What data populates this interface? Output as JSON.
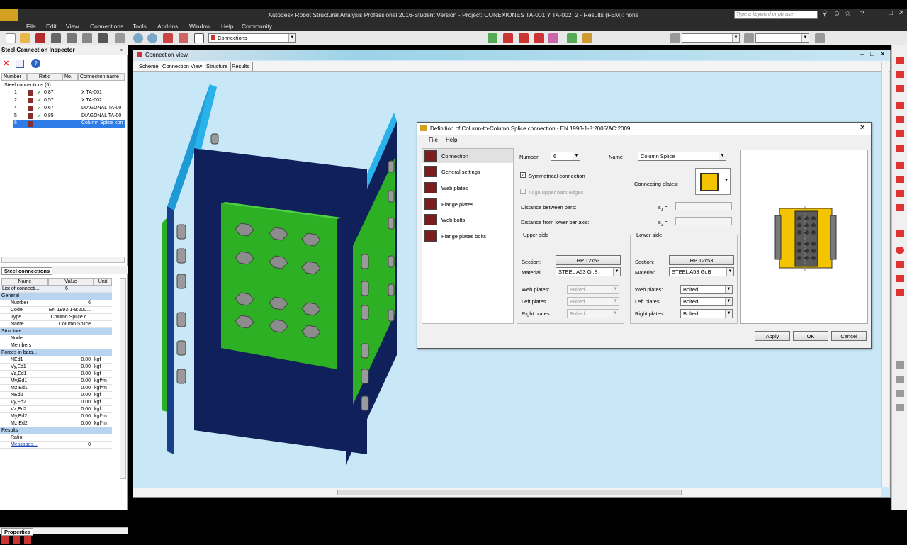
{
  "app": {
    "title": "Autodesk Robot Structural Analysis Professional 2016-Student Version - Project: CONEXIONES TA-001 Y TA-002_2 - Results (FEM): none",
    "search_placeholder": "Type a keyword or phrase"
  },
  "menu": [
    "File",
    "Edit",
    "View",
    "Connections",
    "Tools",
    "Add-Ins",
    "Window",
    "Help",
    "Community"
  ],
  "toolbar": {
    "connections_combo": "Connections"
  },
  "inspector": {
    "title": "Steel Connection Inspector",
    "columns": [
      "Number",
      "Ratio",
      "No.",
      "Connection name"
    ],
    "root_label": "Steel connections (5)",
    "rows": [
      {
        "number": "1",
        "ratio": "0.87",
        "name": "X TA-001"
      },
      {
        "number": "2",
        "ratio": "0.57",
        "name": "X TA-002"
      },
      {
        "number": "4",
        "ratio": "0.67",
        "name": "DIAGONAL TA-00"
      },
      {
        "number": "5",
        "ratio": "0.85",
        "name": "DIAGONAL TA-00"
      },
      {
        "number": "6",
        "ratio": "",
        "name": "Column Splice con"
      }
    ],
    "tab_label": "Steel connections"
  },
  "properties": {
    "columns": [
      "Name",
      "Value",
      "Unit"
    ],
    "list_label": "List of connecti...",
    "list_value": "6",
    "cat_general": "General",
    "general": [
      {
        "name": "Number",
        "value": "6",
        "unit": ""
      },
      {
        "name": "Code",
        "value": "EN 1993-1-8:200...",
        "unit": ""
      },
      {
        "name": "Type",
        "value": "Column Splice c...",
        "unit": ""
      },
      {
        "name": "Name",
        "value": "Column Splice",
        "unit": ""
      }
    ],
    "cat_structure": "Structure",
    "structure": [
      {
        "name": "Node",
        "value": "",
        "unit": ""
      },
      {
        "name": "Members",
        "value": "",
        "unit": ""
      }
    ],
    "cat_forces": "Forces in bars...",
    "forces": [
      {
        "name": "NEd1",
        "value": "0.00",
        "unit": "kgf"
      },
      {
        "name": "Vy,Ed1",
        "value": "0.00",
        "unit": "kgf"
      },
      {
        "name": "Vz,Ed1",
        "value": "0.00",
        "unit": "kgf"
      },
      {
        "name": "My,Ed1",
        "value": "0.00",
        "unit": "kgf*m"
      },
      {
        "name": "Mz,Ed1",
        "value": "0.00",
        "unit": "kgf*m"
      },
      {
        "name": "NEd2",
        "value": "0.00",
        "unit": "kgf"
      },
      {
        "name": "Vy,Ed2",
        "value": "0.00",
        "unit": "kgf"
      },
      {
        "name": "Vz,Ed2",
        "value": "0.00",
        "unit": "kgf"
      },
      {
        "name": "My,Ed2",
        "value": "0.00",
        "unit": "kgf*m"
      },
      {
        "name": "Mz,Ed2",
        "value": "0.00",
        "unit": "kgf*m"
      }
    ],
    "cat_results": "Results",
    "results": [
      {
        "name": "Ratio",
        "value": "",
        "unit": ""
      },
      {
        "name": "Messages...",
        "value": "0",
        "unit": ""
      }
    ],
    "tab_label": "Properties"
  },
  "view": {
    "title": "Connection View",
    "tabs": [
      "Scheme",
      "Connection View",
      "Structure",
      "Results"
    ],
    "active_tab": 1
  },
  "dialog": {
    "title": "Definition of Column-to-Column Splice connection - EN 1993-1-8:2005/AC:2009",
    "menu": [
      "File",
      "Help"
    ],
    "nav": [
      "Connection",
      "General settings",
      "Web plates",
      "Flange plates",
      "Web bolts",
      "Flange plates bolts"
    ],
    "number_label": "Number",
    "number_value": "6",
    "name_label": "Name",
    "name_value": "Column Splice",
    "symmetrical_label": "Symmetrical connection",
    "align_label": "Align upper bars edges",
    "connecting_label": "Connecting plates:",
    "distance_bars_label": "Distance between bars:",
    "distance_lower_label": "Distance from lower bar axis:",
    "s1_label": "s",
    "s1_sub": "1",
    "s2_label": "s",
    "s2_sub": "2",
    "eq": "=",
    "upper": {
      "title": "Upper side",
      "section_label": "Section:",
      "section_value": "HP 12x53",
      "material_label": "Material:",
      "material_value": "STEEL A53 Gr.B",
      "web_label": "Web plates:",
      "web_value": "Bolted",
      "left_label": "Left plates",
      "left_value": "Bolted",
      "right_label": "Right plates",
      "right_value": "Bolted"
    },
    "lower": {
      "title": "Lower side",
      "section_label": "Section:",
      "section_value": "HP 12x53",
      "material_label": "Material:",
      "material_value": "STEEL A53 Gr.B",
      "web_label": "Web plates:",
      "web_value": "Bolted",
      "left_label": "Left plates",
      "left_value": "Bolted",
      "right_label": "Right plates",
      "right_value": "Bolted"
    },
    "apply": "Apply",
    "ok": "OK",
    "cancel": "Cancel"
  },
  "colors": {
    "plate_green": "#2db024",
    "plate_dark": "#10205a",
    "flange_blue": "#1e9ad6",
    "bolt_gray": "#8c8c8c",
    "preview_yellow": "#f5c400",
    "accent_red": "#c8282a"
  }
}
